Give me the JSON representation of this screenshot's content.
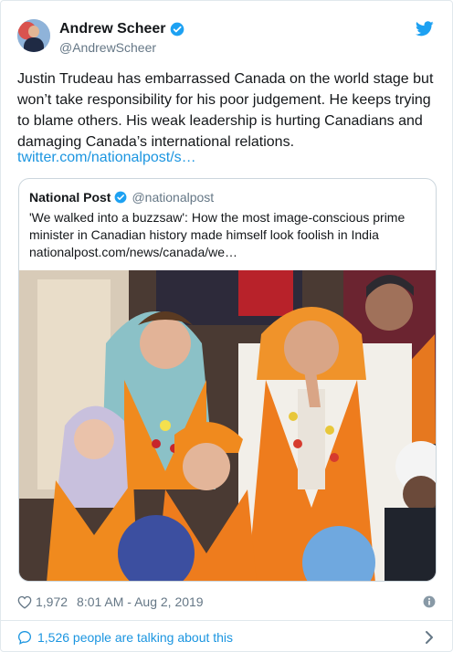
{
  "tweet": {
    "author_name": "Andrew Scheer",
    "author_handle": "@AndrewScheer",
    "text": "Justin Trudeau has embarrassed Canada on the world stage but won’t take responsibility for his poor judgement. He keeps trying to blame others. His weak leadership is hurting Canadians and damaging Canada’s international relations.",
    "link": "twitter.com/nationalpost/s…",
    "like_count": "1,972",
    "timestamp": "8:01 AM - Aug 2, 2019",
    "talking_text": "1,526 people are talking about this"
  },
  "quote": {
    "author_name": "National Post",
    "author_handle": "@nationalpost",
    "text": "'We walked into a buzzsaw': How the most image-conscious prime minister in Canadian history made himself look foolish in India",
    "link": "nationalpost.com/news/canada/we…"
  },
  "icons": {
    "verified": "verified-badge-icon",
    "twitter": "twitter-bird-icon",
    "like": "heart-icon",
    "info": "info-icon",
    "reply": "speech-bubble-icon",
    "more": "chevron-right-icon"
  },
  "colors": {
    "link": "#1b95e0",
    "verified": "#1da1f2",
    "text": "#14171a",
    "secondary": "#657786",
    "border": "#e1e8ed"
  }
}
